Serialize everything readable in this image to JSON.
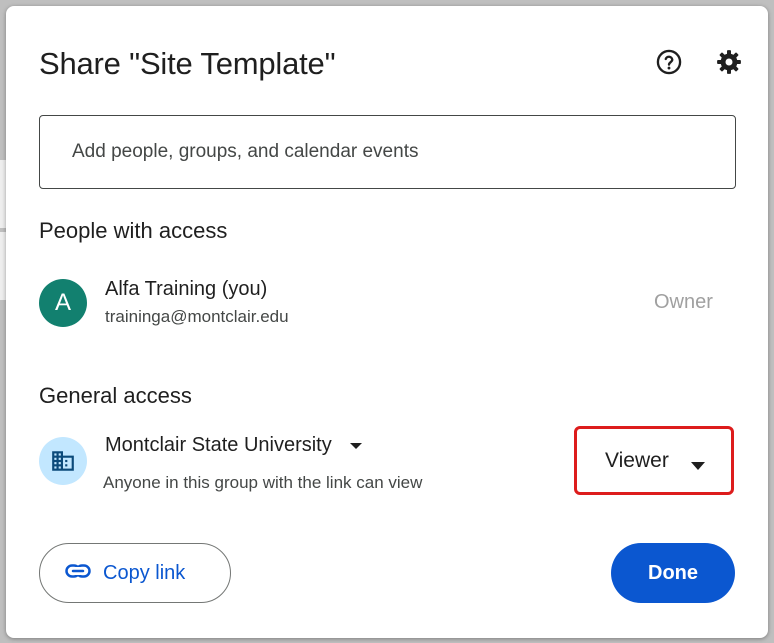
{
  "dialog": {
    "title": "Share \"Site Template\"",
    "help_icon": "help-circle-icon",
    "settings_icon": "gear-icon"
  },
  "add_people": {
    "placeholder": "Add people, groups, and calendar events"
  },
  "people_with_access": {
    "heading": "People with access",
    "people": [
      {
        "avatar_letter": "A",
        "name": "Alfa Training (you)",
        "email": "traininga@montclair.edu",
        "role": "Owner"
      }
    ]
  },
  "general_access": {
    "heading": "General access",
    "org_icon": "building-icon",
    "org_name": "Montclair State University",
    "description": "Anyone in this group with the link can view",
    "role": "Viewer"
  },
  "footer": {
    "copy_link_label": "Copy link",
    "copy_link_icon": "link-icon",
    "done_label": "Done"
  },
  "colors": {
    "accent": "#0b57d0",
    "avatar_bg": "#12806f",
    "org_icon_bg": "#c2e7ff",
    "highlight_border": "#dd1c1c"
  }
}
